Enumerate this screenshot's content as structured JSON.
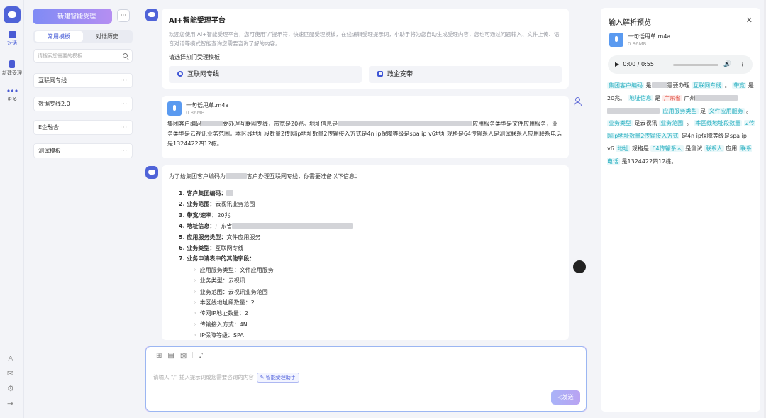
{
  "rail": {
    "chat_label": "对话",
    "new_label": "新建受理",
    "more_label": "更多"
  },
  "sidebar": {
    "new_button_label": "新建智能受理",
    "tabs": [
      "常用模板",
      "对话历史"
    ],
    "search_placeholder": "请搜索您需要的模板",
    "templates": [
      "互联网专线",
      "数据专线2.0",
      "E企融合",
      "测试模板"
    ]
  },
  "welcome": {
    "title": "AI+智能受理平台",
    "description": "欢迎您使用 AI+智能受理平台，您可使用\"/\"提示符，快速匹配受理模板，在线编辑受理提示词，小助手将为您自动生成受理内容，您也可通过问题输入、文件上传、语音对话等模式智能查询您需要咨询了解的内容。",
    "pick_label": "请选择热门受理模板",
    "hot_templates": [
      "互联网专线",
      "政企宽带"
    ]
  },
  "user_message": {
    "file_name": "一句话甩单.m4a",
    "file_size": "0.86MB",
    "text_a": "集团客户编码",
    "text_b": "要办理互联网专线，带宽是20兆。地址信息是",
    "text_c": "应用服务类型是文件应用服务，业务类型是云视讯业务范围。本区线地址段数量2传网ip地址数量2传输接入方式是4n ip保障等级是spa ip v6地址规格是64传输系人是测试联系人应用联系电话是1324422四12栋。"
  },
  "reply": {
    "intro_a": "为了给集团客户编码为",
    "intro_b": "客户办理互联网专线，你需要准备以下信息：",
    "items": [
      {
        "label": "1. 客户集团编码：",
        "value": ""
      },
      {
        "label": "2. 业务范围：",
        "value": "云视讯业务范围"
      },
      {
        "label": "3. 带宽/速率：",
        "value": "20兆"
      },
      {
        "label": "4. 地址信息：",
        "value": "广东省"
      },
      {
        "label": "5. 应用服务类型：",
        "value": "文件应用服务"
      },
      {
        "label": "6. 业务类型：",
        "value": "互联网专线"
      },
      {
        "label": "7. 业务申请表中的其他字段：",
        "value": ""
      }
    ],
    "sub_items": [
      "应用服务类型：文件应用服务",
      "业务类型：云视讯",
      "业务范围：云视讯业务范围",
      "本区线地址段数量：2",
      "传网IP地址数量：2",
      "传输接入方式：4N",
      "IP保障等级：SPA"
    ]
  },
  "composer": {
    "placeholder": "请输入 \"/\" 插入提示词或您需要咨询的内容",
    "chip_label": "智能受理助手",
    "send_label": "发送"
  },
  "panel": {
    "title": "输入解析预览",
    "file_name": "一句话甩单.m4a",
    "file_size": "0.86MB",
    "audio_time": "0:00 / 0:55",
    "parsed": [
      {
        "t": "集团客户编码",
        "tag": true
      },
      {
        "t": " 是",
        "tag": false
      },
      {
        "t": "blur",
        "tag": false,
        "w": 22
      },
      {
        "t": "需要办理 ",
        "tag": false
      },
      {
        "t": "互联网专线",
        "tag": true
      },
      {
        "t": " 。 ",
        "tag": false
      },
      {
        "t": "带宽",
        "tag": true
      },
      {
        "t": " 是 20兆。 ",
        "tag": false
      },
      {
        "t": "地址信息",
        "tag": true
      },
      {
        "t": " 是 ",
        "tag": false
      },
      {
        "t": "广东省",
        "tag": true,
        "red": true
      },
      {
        "t": " 广州",
        "tag": false
      },
      {
        "t": "blur",
        "tag": false,
        "w": 60
      },
      {
        "t": "blur",
        "tag": false,
        "w": 74
      },
      {
        "t": " ",
        "tag": false
      },
      {
        "t": "应用服务类型",
        "tag": true
      },
      {
        "t": " 是 ",
        "tag": false
      },
      {
        "t": "文件应用服务",
        "tag": true
      },
      {
        "t": " 。 ",
        "tag": false
      },
      {
        "t": "业务类型",
        "tag": true
      },
      {
        "t": " 是云视讯 ",
        "tag": false
      },
      {
        "t": "业务范围",
        "tag": true
      },
      {
        "t": " 。 ",
        "tag": false
      },
      {
        "t": "本区线地址段数量",
        "tag": true
      },
      {
        "t": " ",
        "tag": false
      },
      {
        "t": "2传网ip地址数量2传输接入方式",
        "tag": true
      },
      {
        "t": " 是4n ip保障等级是spa ip v6 ",
        "tag": false
      },
      {
        "t": "地址",
        "tag": true
      },
      {
        "t": " 规格是 ",
        "tag": false
      },
      {
        "t": "64传输系人",
        "tag": true
      },
      {
        "t": " 是测试 ",
        "tag": false
      },
      {
        "t": "联系人",
        "tag": true
      },
      {
        "t": " 应用 ",
        "tag": false
      },
      {
        "t": "联系电话",
        "tag": true
      },
      {
        "t": " 是1324422四12栋。",
        "tag": false
      }
    ]
  }
}
